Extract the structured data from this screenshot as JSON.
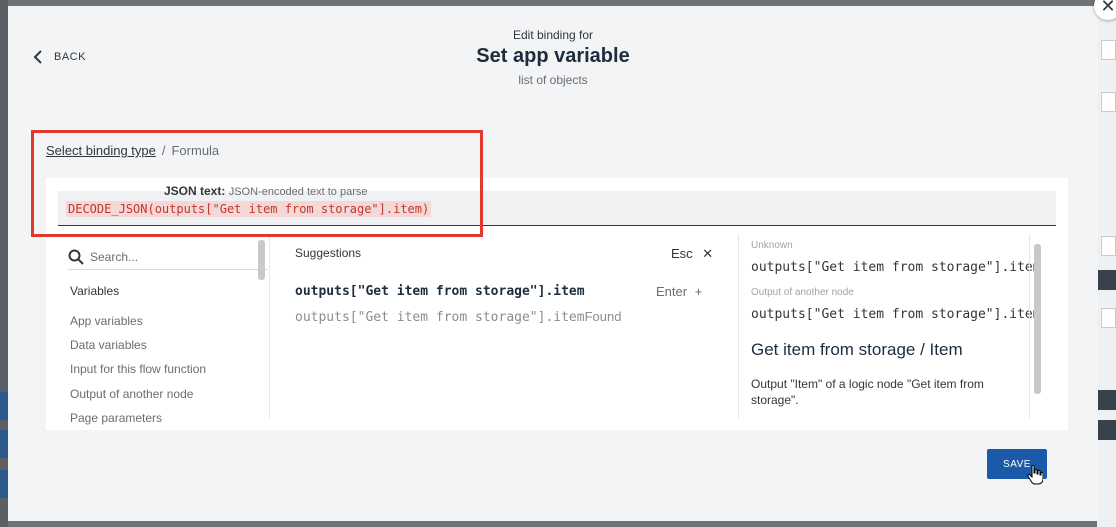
{
  "header": {
    "kicker": "Edit binding for",
    "title": "Set app variable",
    "subtitle": "list of objects",
    "back_label": "BACK"
  },
  "breadcrumb": {
    "link": "Select binding type",
    "separator": "/",
    "current": "Formula"
  },
  "formula": {
    "label": "JSON text:",
    "hint": "JSON-encoded text to parse",
    "code": "DECODE_JSON(outputs[\"Get item from storage\"].item)"
  },
  "variables": {
    "search_placeholder": "Search...",
    "title": "Variables",
    "items": [
      "App variables",
      "Data variables",
      "Input for this flow function",
      "Output of another node",
      "Page parameters"
    ]
  },
  "suggestions": {
    "title": "Suggestions",
    "esc_label": "Esc",
    "main": "outputs[\"Get item from storage\"].item",
    "enter_label": "Enter",
    "sub_code": "outputs[\"Get item from storage\"].item",
    "sub_tail": "Found"
  },
  "details": {
    "tag1": "Unknown",
    "code1": "outputs[\"Get item from storage\"].item",
    "tag2": "Output of another node",
    "code2": "outputs[\"Get item from storage\"].item",
    "title": "Get item from storage / Item",
    "description": "Output \"Item\" of a logic node \"Get item from storage\"."
  },
  "actions": {
    "save_label": "SAVE"
  },
  "colors": {
    "accent": "#1a5aa8",
    "highlight_border": "#e03a2e",
    "formula_text": "#c0392b"
  }
}
